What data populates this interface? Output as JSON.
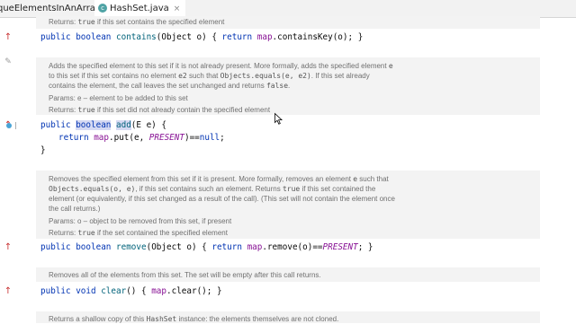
{
  "tabs": [
    {
      "label": "queElementsInAnArray.java",
      "close": "×",
      "active": false
    },
    {
      "label": "HashSet.java",
      "close": "×",
      "active": true,
      "icon": "c"
    }
  ],
  "docs": {
    "contains_returns": {
      "prefix": "Returns: ",
      "code": "true",
      "suffix": " if this set contains the specified element"
    },
    "add": {
      "line1": {
        "t1": "Adds the specified element to this set if it is not already present. More formally, adds the specified element ",
        "c1": "e"
      },
      "line2": {
        "t1": "to this set if this set contains no element ",
        "c1": "e2",
        "t2": " such that ",
        "c2": "Objects.equals(e, e2)",
        "t3": ". If this set already"
      },
      "line3": {
        "t1": "contains the element, the call leaves the set unchanged and returns ",
        "c1": "false",
        "t2": "."
      },
      "params": "Params: e – element to be added to this set",
      "returns": {
        "prefix": "Returns: ",
        "code": "true",
        "suffix": " if this set did not already contain the specified element"
      }
    },
    "remove": {
      "line1": {
        "t1": "Removes the specified element from this set if it is present. More formally, removes an element ",
        "c1": "e",
        "t2": " such that"
      },
      "line2": {
        "c1": "Objects.equals(o, e)",
        "t1": ", if this set contains such an element. Returns ",
        "c2": "true",
        "t2": " if this set contained the"
      },
      "line3": "element (or equivalently, if this set changed as a result of the call). (This set will not contain the element once",
      "line4": "the call returns.)",
      "params": "Params: o – object to be removed from this set, if present",
      "returns": {
        "prefix": "Returns: ",
        "code": "true",
        "suffix": " if the set contained the specified element"
      }
    },
    "clear": "Removes all of the elements from this set. The set will be empty after this call returns.",
    "clone": {
      "t1": "Returns a shallow copy of this ",
      "c1": "HashSet",
      "t2": " instance: the elements themselves are not cloned."
    }
  },
  "code": {
    "contains": {
      "kw1": "public",
      "kw2": "boolean",
      "fn": "contains",
      "args": "(Object o) { ",
      "kw3": "return",
      "fld": "map",
      "rest": ".containsKey(o); }"
    },
    "add_sig": {
      "kw1": "public",
      "kw2": "boolean",
      "fn": "add",
      "rest": "(E e) {"
    },
    "add_body": {
      "kw1": "return",
      "fld": "map",
      "mid": ".put(e, ",
      "const": "PRESENT",
      "rest": ")==",
      "kw2": "null",
      "end": ";"
    },
    "add_close": "}",
    "remove": {
      "kw1": "public",
      "kw2": "boolean",
      "fn": "remove",
      "args": "(Object o) { ",
      "kw3": "return",
      "fld": "map",
      "mid": ".remove(o)==",
      "const": "PRESENT",
      "rest": "; }"
    },
    "clear": {
      "kw1": "public",
      "kw2": "void",
      "fn": "clear",
      "args": "() { ",
      "fld": "map",
      "rest": ".clear(); }"
    }
  },
  "gutter": {
    "override_marker": "↑",
    "edit_icon": "✎"
  },
  "colors": {
    "keyword": "#0033b3",
    "method": "#00627a",
    "field": "#871094",
    "doc_bg": "#f3f3f3",
    "tab_underline": "#4a86c7"
  }
}
